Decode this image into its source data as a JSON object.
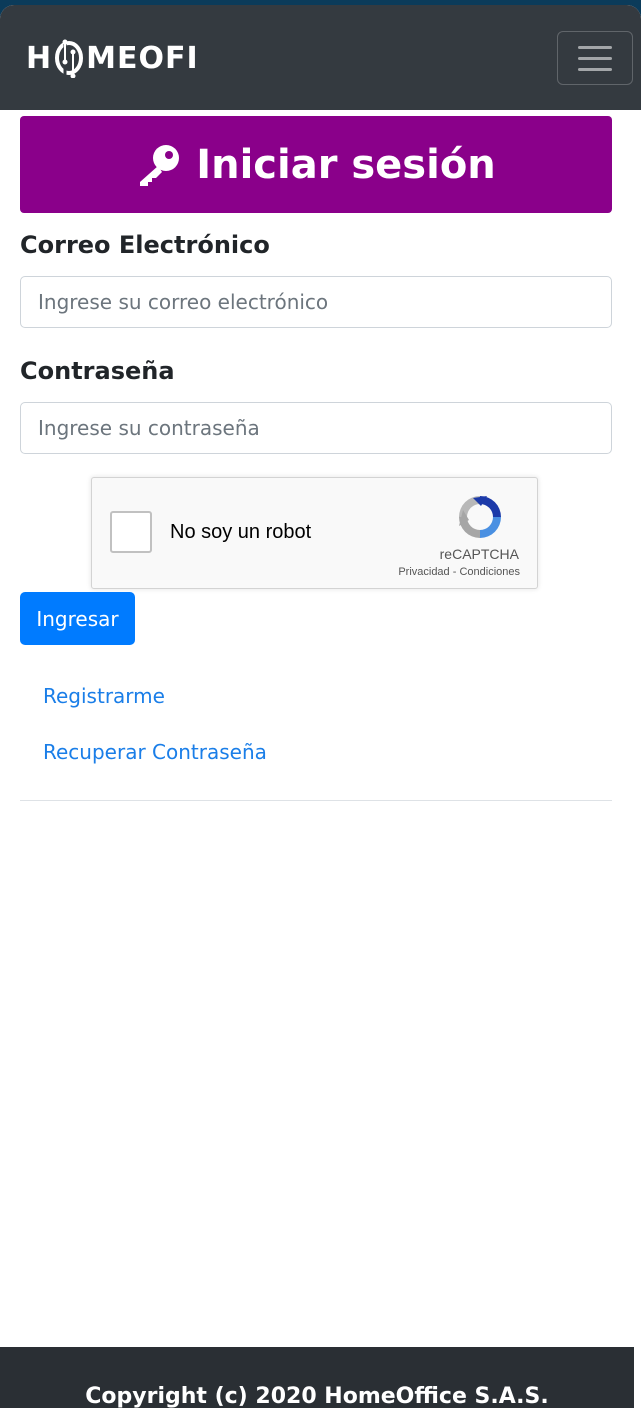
{
  "navbar": {
    "brand_left": "H",
    "brand_right": "MEOFI",
    "menu_icon": "hamburger-icon"
  },
  "login": {
    "title": "Iniciar sesión",
    "title_icon": "key-icon",
    "email_label": "Correo Electrónico",
    "email_placeholder": "Ingrese su correo electrónico",
    "email_value": "",
    "password_label": "Contraseña",
    "password_placeholder": "Ingrese su contraseña",
    "password_value": "",
    "submit_label": "Ingresar",
    "register_link": "Registrarme",
    "recover_link": "Recuperar Contraseña"
  },
  "captcha": {
    "label": "No soy un robot",
    "brand": "reCAPTCHA",
    "privacy": "Privacidad",
    "separator": " - ",
    "terms": "Condiciones",
    "checked": false
  },
  "footer": {
    "copyright": "Copyright (c) 2020 HomeOffice S.A.S."
  },
  "colors": {
    "navbar": "#343a40",
    "title_bar": "#8a008a",
    "primary": "#007bff",
    "link": "#1a7ee8",
    "footer": "#2a2f34"
  }
}
